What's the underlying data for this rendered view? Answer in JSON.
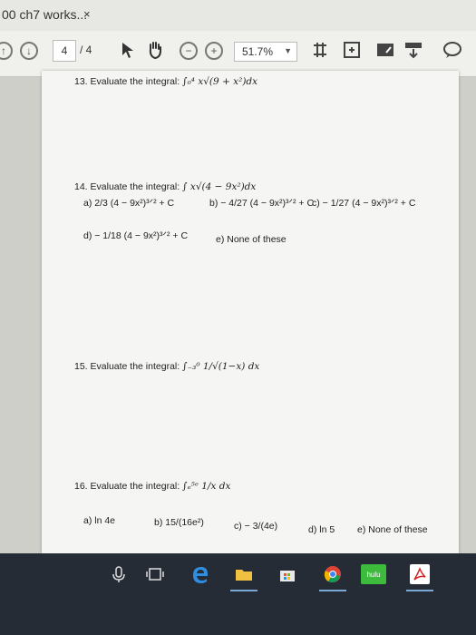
{
  "tab": {
    "title": "00 ch7 works...",
    "close": "×"
  },
  "toolbar": {
    "page_current": "4",
    "page_total": "/ 4",
    "zoom": "51.7%"
  },
  "questions": {
    "q13": {
      "label": "13. Evaluate the integral:",
      "expr": "∫₀⁴ x√(9 + x²)dx"
    },
    "q14": {
      "label": "14. Evaluate the integral:",
      "expr": "∫ x√(4 − 9x²)dx",
      "a": "a) 2/3 (4 − 9x²)³ᐟ² + C",
      "b": "b) − 4/27 (4 − 9x²)³ᐟ² + C",
      "c": "c) − 1/27 (4 − 9x²)³ᐟ² + C",
      "d": "d) − 1/18 (4 − 9x²)³ᐟ² + C",
      "e": "e) None of these"
    },
    "q15": {
      "label": "15. Evaluate the integral:",
      "expr": "∫₋₃⁰ 1/√(1−x) dx"
    },
    "q16": {
      "label": "16. Evaluate the integral:",
      "expr": "∫ₑ⁵ᵉ 1/x dx",
      "a": "a) ln 4e",
      "b": "b) 15/(16e²)",
      "c": "c) − 3/(4e)",
      "d": "d) ln 5",
      "e": "e) None of these"
    }
  },
  "taskbar": {
    "hulu": "hulu"
  }
}
